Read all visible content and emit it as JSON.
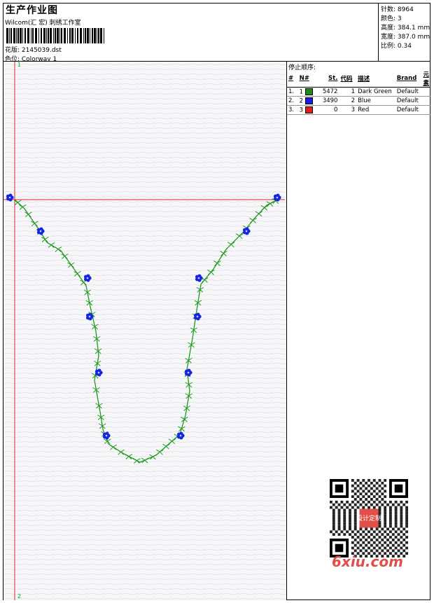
{
  "header": {
    "title": "生产作业图",
    "studio": "Wilcom(汇 宏) 刺绣工作室",
    "design_file": "花版: 2145039.dst",
    "colorway": "色位: Colorway 1"
  },
  "specs": [
    {
      "label": "针数:",
      "value": "8964"
    },
    {
      "label": "颜色:",
      "value": "3"
    },
    {
      "label": "高度:",
      "value": "384.1 mm"
    },
    {
      "label": "宽度:",
      "value": "387.0 mm"
    },
    {
      "label": "比例:",
      "value": "0.34"
    }
  ],
  "stop_sequence": {
    "title": "停止顺序:",
    "columns": [
      "#",
      "N#",
      "St.",
      "代码",
      "描述",
      "Brand",
      "元素"
    ],
    "rows": [
      {
        "num": "1.",
        "n": "1",
        "color": "#1a8a1a",
        "stitches": "5472",
        "code": "1",
        "desc": "Dark Green",
        "brand": "Default"
      },
      {
        "num": "2.",
        "n": "2",
        "color": "#1a1ae6",
        "stitches": "3490",
        "code": "2",
        "desc": "Blue",
        "brand": "Default"
      },
      {
        "num": "3.",
        "n": "3",
        "color": "#e61a1a",
        "stitches": "0",
        "code": "3",
        "desc": "Red",
        "brand": "Default"
      }
    ]
  },
  "canvas": {
    "marker_start": "1",
    "marker_end": "2"
  },
  "watermark": {
    "text": "6xiu.com",
    "seal_text": "设计定制"
  },
  "colors": {
    "vine": "#1f9a1f",
    "flower": "#1525e0",
    "guide": "#e0201e"
  }
}
